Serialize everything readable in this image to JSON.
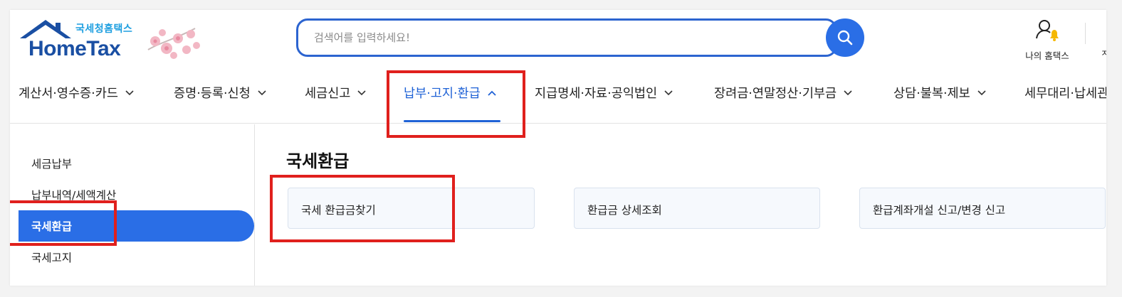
{
  "header": {
    "logo_sub": "국세청홈택스",
    "logo_main": "HomeTax",
    "search_placeholder": "검색어를 입력하세요!",
    "my_hometax": "나의 홈택스",
    "cut_text": "ㅈ"
  },
  "gnb": [
    {
      "label": "계산서·영수증·카드",
      "icon": "chevron-down-icon"
    },
    {
      "label": "증명·등록·신청",
      "icon": "chevron-down-icon"
    },
    {
      "label": "세금신고",
      "icon": "chevron-down-icon"
    },
    {
      "label": "납부·고지·환급",
      "icon": "chevron-up-icon",
      "active": true
    },
    {
      "label": "지급명세·자료·공익법인",
      "icon": "chevron-down-icon"
    },
    {
      "label": "장려금·연말정산·기부금",
      "icon": "chevron-down-icon"
    },
    {
      "label": "상담·불복·제보",
      "icon": "chevron-down-icon"
    },
    {
      "label": "세무대리·납세관",
      "icon": ""
    }
  ],
  "sidebar": {
    "items": [
      {
        "label": "세금납부"
      },
      {
        "label": "납부내역/세액계산"
      },
      {
        "label": "국세환급",
        "active": true
      },
      {
        "label": "국세고지"
      }
    ]
  },
  "content": {
    "title": "국세환급",
    "cards": [
      {
        "label": "국세 환급금찾기"
      },
      {
        "label": "환급금 상세조회"
      },
      {
        "label": "환급계좌개설 신고/변경 신고"
      }
    ]
  },
  "colors": {
    "accent": "#2a6ee6",
    "active_text": "#1f62d6",
    "annotation": "#e0201d",
    "logo_blue": "#1a4fa3"
  }
}
